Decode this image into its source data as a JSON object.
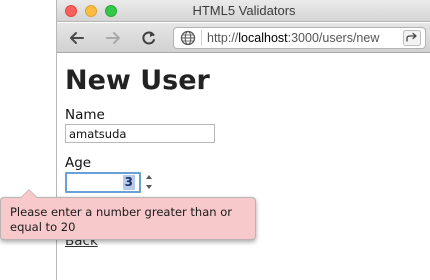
{
  "window": {
    "title": "HTML5 Validators"
  },
  "toolbar": {
    "back_icon": "arrow-left-icon",
    "forward_icon": "arrow-right-icon",
    "reload_icon": "reload-icon",
    "address": {
      "protocol": "http://",
      "host": "localhost",
      "rest": ":3000/users/new"
    },
    "share_icon": "share-icon"
  },
  "page": {
    "title": "New User",
    "name_label": "Name",
    "name_value": "amatsuda",
    "age_label": "Age",
    "age_value": "3",
    "back_link": "Back"
  },
  "validation": {
    "message": "Please enter a number greater than or equal to 20"
  },
  "colors": {
    "tooltip_bg": "#f8c9cb",
    "focus_border": "#6aa0d8",
    "close": "#fc605c",
    "minimize": "#fdbc40",
    "zoom": "#34c84a"
  }
}
